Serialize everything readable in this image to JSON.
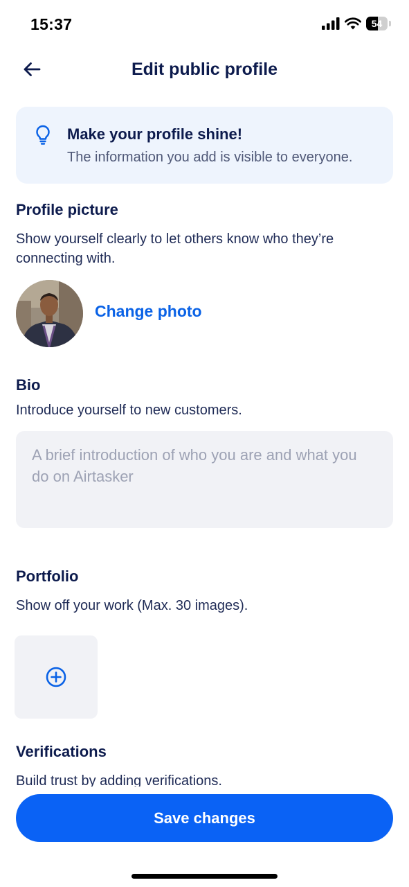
{
  "status": {
    "time": "15:37",
    "battery_label": "54",
    "battery_level": 0.54
  },
  "header": {
    "title": "Edit public profile",
    "back_icon": "arrow-left-icon"
  },
  "tip": {
    "icon": "lightbulb-icon",
    "title": "Make your profile shine!",
    "text": "The information you add is visible to everyone."
  },
  "profile_picture": {
    "title": "Profile picture",
    "description": "Show yourself clearly to let others know who they’re connecting with.",
    "change_label": "Change photo"
  },
  "bio": {
    "title": "Bio",
    "description": "Introduce yourself to new customers.",
    "value": "",
    "placeholder": "A brief introduction of who you are and what you do on Airtasker"
  },
  "portfolio": {
    "title": "Portfolio",
    "description": "Show off your work (Max. 30 images).",
    "add_icon": "plus-circle-icon"
  },
  "verifications": {
    "title": "Verifications",
    "description": "Build trust by adding verifications."
  },
  "footer": {
    "save_label": "Save changes"
  },
  "colors": {
    "primary": "#0a62f5",
    "link": "#0a62e6",
    "text_dark": "#0d1b4d",
    "tip_background": "#eef4fd",
    "field_background": "#f1f2f6"
  }
}
